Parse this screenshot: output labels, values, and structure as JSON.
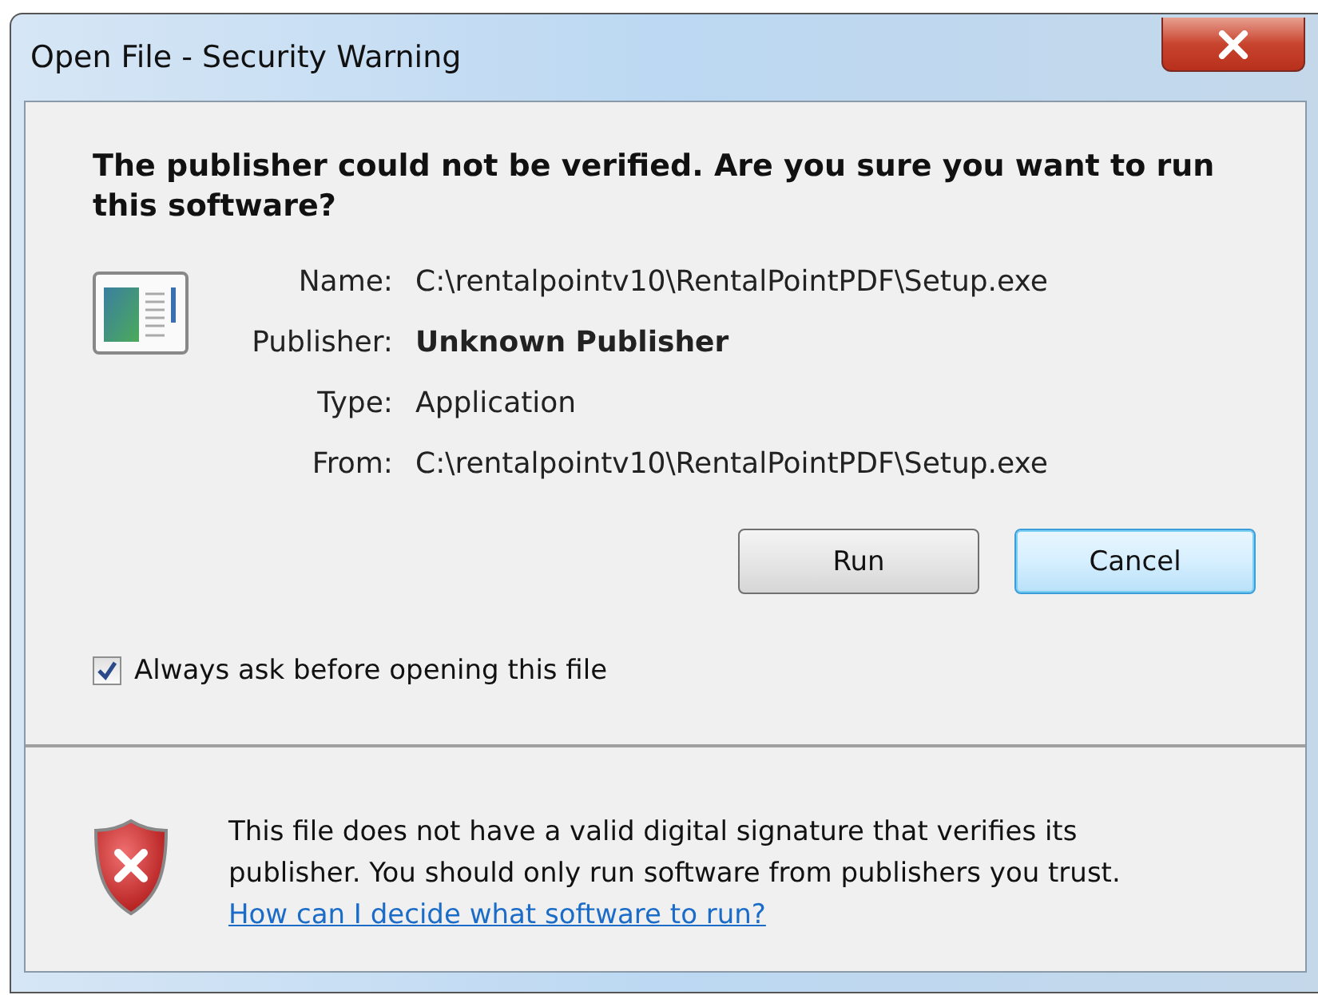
{
  "window": {
    "title": "Open File - Security Warning"
  },
  "heading": "The publisher could not be verified.  Are you sure you want to run this software?",
  "details": [
    {
      "label": "Name:",
      "value": "C:\\rentalpointv10\\RentalPointPDF\\Setup.exe",
      "bold": false
    },
    {
      "label": "Publisher:",
      "value": "Unknown Publisher",
      "bold": true
    },
    {
      "label": "Type:",
      "value": "Application",
      "bold": false
    },
    {
      "label": "From:",
      "value": "C:\\rentalpointv10\\RentalPointPDF\\Setup.exe",
      "bold": false
    }
  ],
  "buttons": [
    {
      "label": "Run",
      "default": false
    },
    {
      "label": "Cancel",
      "default": true
    }
  ],
  "checkbox": {
    "label": "Always ask before opening this file",
    "checked": true
  },
  "warning": {
    "text": "This file does not have a valid digital signature that verifies its publisher.  You should only run software from publishers you trust.",
    "link": "How can I decide what software to run?"
  }
}
